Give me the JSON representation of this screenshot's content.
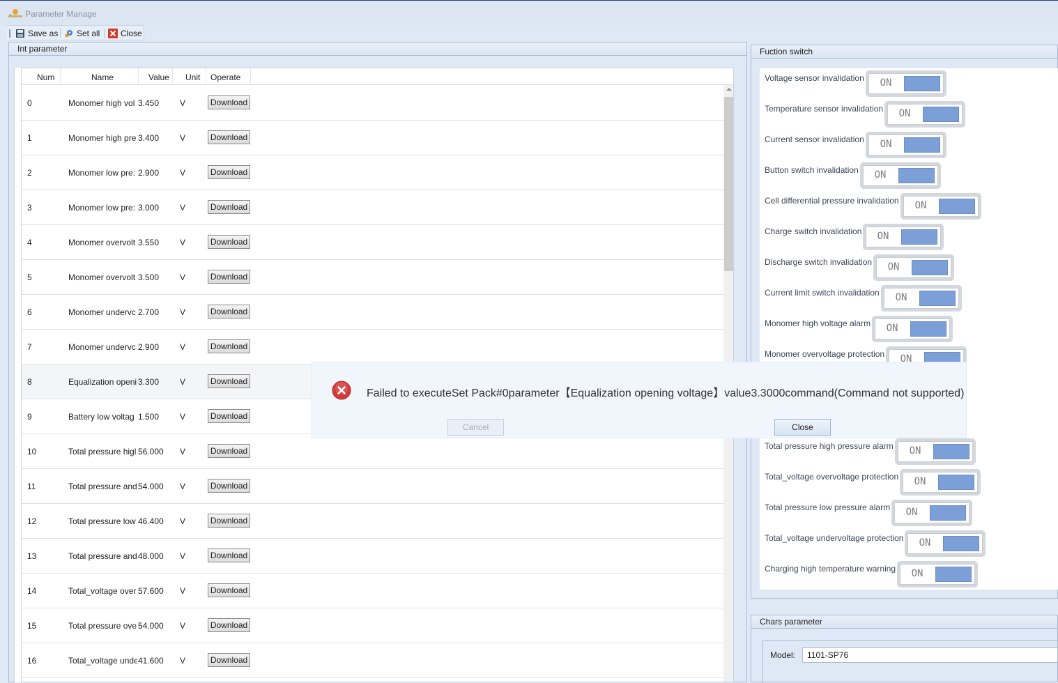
{
  "window": {
    "title": "Parameter Manage"
  },
  "toolbar": {
    "save_as": "Save as",
    "set_all": "Set all",
    "close": "Close"
  },
  "int_panel": {
    "title": "Int parameter",
    "columns": [
      "Num",
      "Name",
      "Value",
      "Unit",
      "Operate"
    ],
    "rows": [
      {
        "num": "0",
        "name": "Monomer high vol",
        "value": "3.450",
        "unit": "V",
        "op": "Download"
      },
      {
        "num": "1",
        "name": "Monomer high pre",
        "value": "3.400",
        "unit": "V",
        "op": "Download"
      },
      {
        "num": "2",
        "name": "Monomer low pre:",
        "value": "2.900",
        "unit": "V",
        "op": "Download"
      },
      {
        "num": "3",
        "name": "Monomer low pre:",
        "value": "3.000",
        "unit": "V",
        "op": "Download"
      },
      {
        "num": "4",
        "name": "Monomer overvolt",
        "value": "3.550",
        "unit": "V",
        "op": "Download"
      },
      {
        "num": "5",
        "name": "Monomer overvolt",
        "value": "3.500",
        "unit": "V",
        "op": "Download"
      },
      {
        "num": "6",
        "name": "Monomer undervc",
        "value": "2.700",
        "unit": "V",
        "op": "Download"
      },
      {
        "num": "7",
        "name": "Monomer undervc",
        "value": "2.900",
        "unit": "V",
        "op": "Download"
      },
      {
        "num": "8",
        "name": "Equalization openi",
        "value": "3.300",
        "unit": "V",
        "op": "Download"
      },
      {
        "num": "9",
        "name": "Battery low voltag",
        "value": "1.500",
        "unit": "V",
        "op": "Download"
      },
      {
        "num": "10",
        "name": "Total pressure higl",
        "value": "56.000",
        "unit": "V",
        "op": "Download"
      },
      {
        "num": "11",
        "name": "Total pressure and",
        "value": "54.000",
        "unit": "V",
        "op": "Download"
      },
      {
        "num": "12",
        "name": "Total pressure low",
        "value": "46.400",
        "unit": "V",
        "op": "Download"
      },
      {
        "num": "13",
        "name": "Total pressure and",
        "value": "48.000",
        "unit": "V",
        "op": "Download"
      },
      {
        "num": "14",
        "name": "Total_voltage over",
        "value": "57.600",
        "unit": "V",
        "op": "Download"
      },
      {
        "num": "15",
        "name": "Total pressure ove",
        "value": "54.000",
        "unit": "V",
        "op": "Download"
      },
      {
        "num": "16",
        "name": "Total_voltage unde",
        "value": "41.600",
        "unit": "V",
        "op": "Download"
      }
    ]
  },
  "function_panel": {
    "title": "Fuction switch",
    "switch_text": "ON",
    "items": [
      "Voltage sensor invalidation",
      "Temperature sensor invalidation",
      "Current sensor invalidation",
      "Button switch invalidation",
      "Cell differential pressure invalidation",
      "Charge switch invalidation",
      "Discharge switch invalidation",
      "Current limit switch invalidation",
      "Monomer high voltage alarm",
      "Monomer overvoltage protection",
      "Total pressure high pressure alarm",
      "Total_voltage overvoltage protection",
      "Total pressure low pressure alarm",
      "Total_voltage undervoltage protection",
      "Charging high temperature warning"
    ]
  },
  "chars_panel": {
    "title": "Chars parameter",
    "model_label": "Model:",
    "model_value": "1101-SP76"
  },
  "dialog": {
    "message": "Failed to executeSet Pack#0parameter【Equalization opening voltage】value3.3000command(Command not supported)",
    "cancel": "Cancel",
    "close": "Close"
  },
  "colors": {
    "toggle_knob": "#7b9fd6",
    "error": "#d33a3a",
    "panel_bg": "#dfe9f5"
  }
}
